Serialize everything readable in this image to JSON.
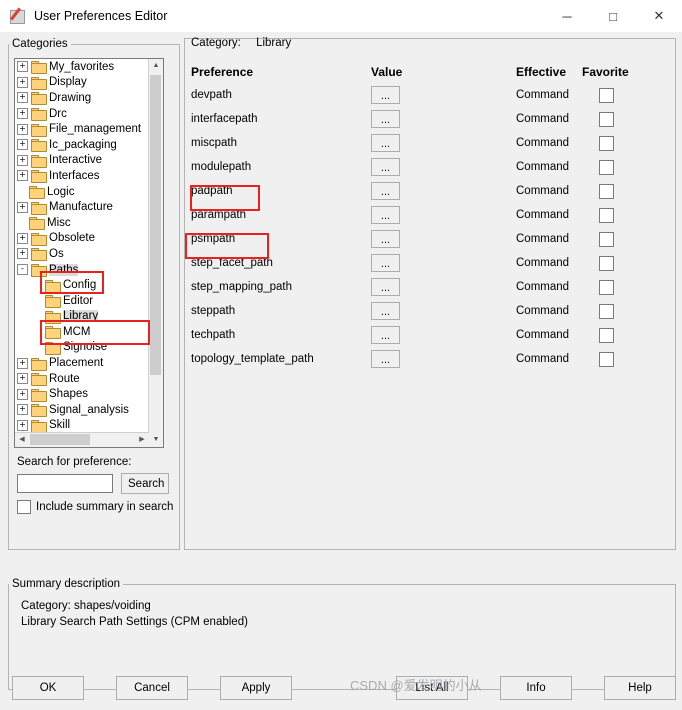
{
  "window": {
    "title": "User Preferences Editor",
    "minimize": "─",
    "maximize": "□",
    "close": "✕"
  },
  "categories": {
    "legend": "Categories",
    "tree": [
      {
        "label": "My_favorites",
        "expander": "+",
        "indent": 1,
        "selected": false
      },
      {
        "label": "Display",
        "expander": "+",
        "indent": 1,
        "selected": false
      },
      {
        "label": "Drawing",
        "expander": "+",
        "indent": 1,
        "selected": false
      },
      {
        "label": "Drc",
        "expander": "+",
        "indent": 1,
        "selected": false
      },
      {
        "label": "File_management",
        "expander": "+",
        "indent": 1,
        "selected": false
      },
      {
        "label": "Ic_packaging",
        "expander": "+",
        "indent": 1,
        "selected": false
      },
      {
        "label": "Interactive",
        "expander": "+",
        "indent": 1,
        "selected": false
      },
      {
        "label": "Interfaces",
        "expander": "+",
        "indent": 1,
        "selected": false
      },
      {
        "label": "Logic",
        "expander": "",
        "indent": 1,
        "selected": false
      },
      {
        "label": "Manufacture",
        "expander": "+",
        "indent": 1,
        "selected": false
      },
      {
        "label": "Misc",
        "expander": "",
        "indent": 1,
        "selected": false
      },
      {
        "label": "Obsolete",
        "expander": "+",
        "indent": 1,
        "selected": false
      },
      {
        "label": "Os",
        "expander": "+",
        "indent": 1,
        "selected": false
      },
      {
        "label": "Paths",
        "expander": "-",
        "indent": 1,
        "selected": true
      },
      {
        "label": "Config",
        "expander": "",
        "indent": 2,
        "selected": false
      },
      {
        "label": "Editor",
        "expander": "",
        "indent": 2,
        "selected": false
      },
      {
        "label": "Library",
        "expander": "",
        "indent": 2,
        "selected": true
      },
      {
        "label": "MCM",
        "expander": "",
        "indent": 2,
        "selected": false
      },
      {
        "label": "Signoise",
        "expander": "",
        "indent": 2,
        "selected": false
      },
      {
        "label": "Placement",
        "expander": "+",
        "indent": 1,
        "selected": false
      },
      {
        "label": "Route",
        "expander": "+",
        "indent": 1,
        "selected": false
      },
      {
        "label": "Shapes",
        "expander": "+",
        "indent": 1,
        "selected": false
      },
      {
        "label": "Signal_analysis",
        "expander": "+",
        "indent": 1,
        "selected": false
      },
      {
        "label": "Skill",
        "expander": "+",
        "indent": 1,
        "selected": false
      }
    ],
    "search_label": "Search for preference:",
    "search_value": "",
    "search_button": "Search",
    "include_summary_label": "Include summary in search",
    "include_summary_checked": false
  },
  "preferences": {
    "category_label": "Category:",
    "category_value": "Library",
    "columns": {
      "preference": "Preference",
      "value": "Value",
      "effective": "Effective",
      "favorite": "Favorite"
    },
    "rows": [
      {
        "name": "devpath",
        "value": "...",
        "effective": "Command",
        "favorite": false
      },
      {
        "name": "interfacepath",
        "value": "...",
        "effective": "Command",
        "favorite": false
      },
      {
        "name": "miscpath",
        "value": "...",
        "effective": "Command",
        "favorite": false
      },
      {
        "name": "modulepath",
        "value": "...",
        "effective": "Command",
        "favorite": false
      },
      {
        "name": "padpath",
        "value": "...",
        "effective": "Command",
        "favorite": false
      },
      {
        "name": "parampath",
        "value": "...",
        "effective": "Command",
        "favorite": false
      },
      {
        "name": "psmpath",
        "value": "...",
        "effective": "Command",
        "favorite": false
      },
      {
        "name": "step_facet_path",
        "value": "...",
        "effective": "Command",
        "favorite": false
      },
      {
        "name": "step_mapping_path",
        "value": "...",
        "effective": "Command",
        "favorite": false
      },
      {
        "name": "steppath",
        "value": "...",
        "effective": "Command",
        "favorite": false
      },
      {
        "name": "techpath",
        "value": "...",
        "effective": "Command",
        "favorite": false
      },
      {
        "name": "topology_template_path",
        "value": "...",
        "effective": "Command",
        "favorite": false
      }
    ]
  },
  "summary": {
    "legend": "Summary description",
    "line1": "Category: shapes/voiding",
    "line2": "Library Search Path Settings (CPM enabled)"
  },
  "buttons": {
    "ok": "OK",
    "cancel": "Cancel",
    "apply": "Apply",
    "list_all": "List All",
    "info": "Info",
    "help": "Help"
  },
  "watermark": "CSDN @爱发明的小从",
  "colors": {
    "highlight": "#e8231f",
    "folder": "#ffd37a",
    "selection": "#dcdcdc"
  }
}
